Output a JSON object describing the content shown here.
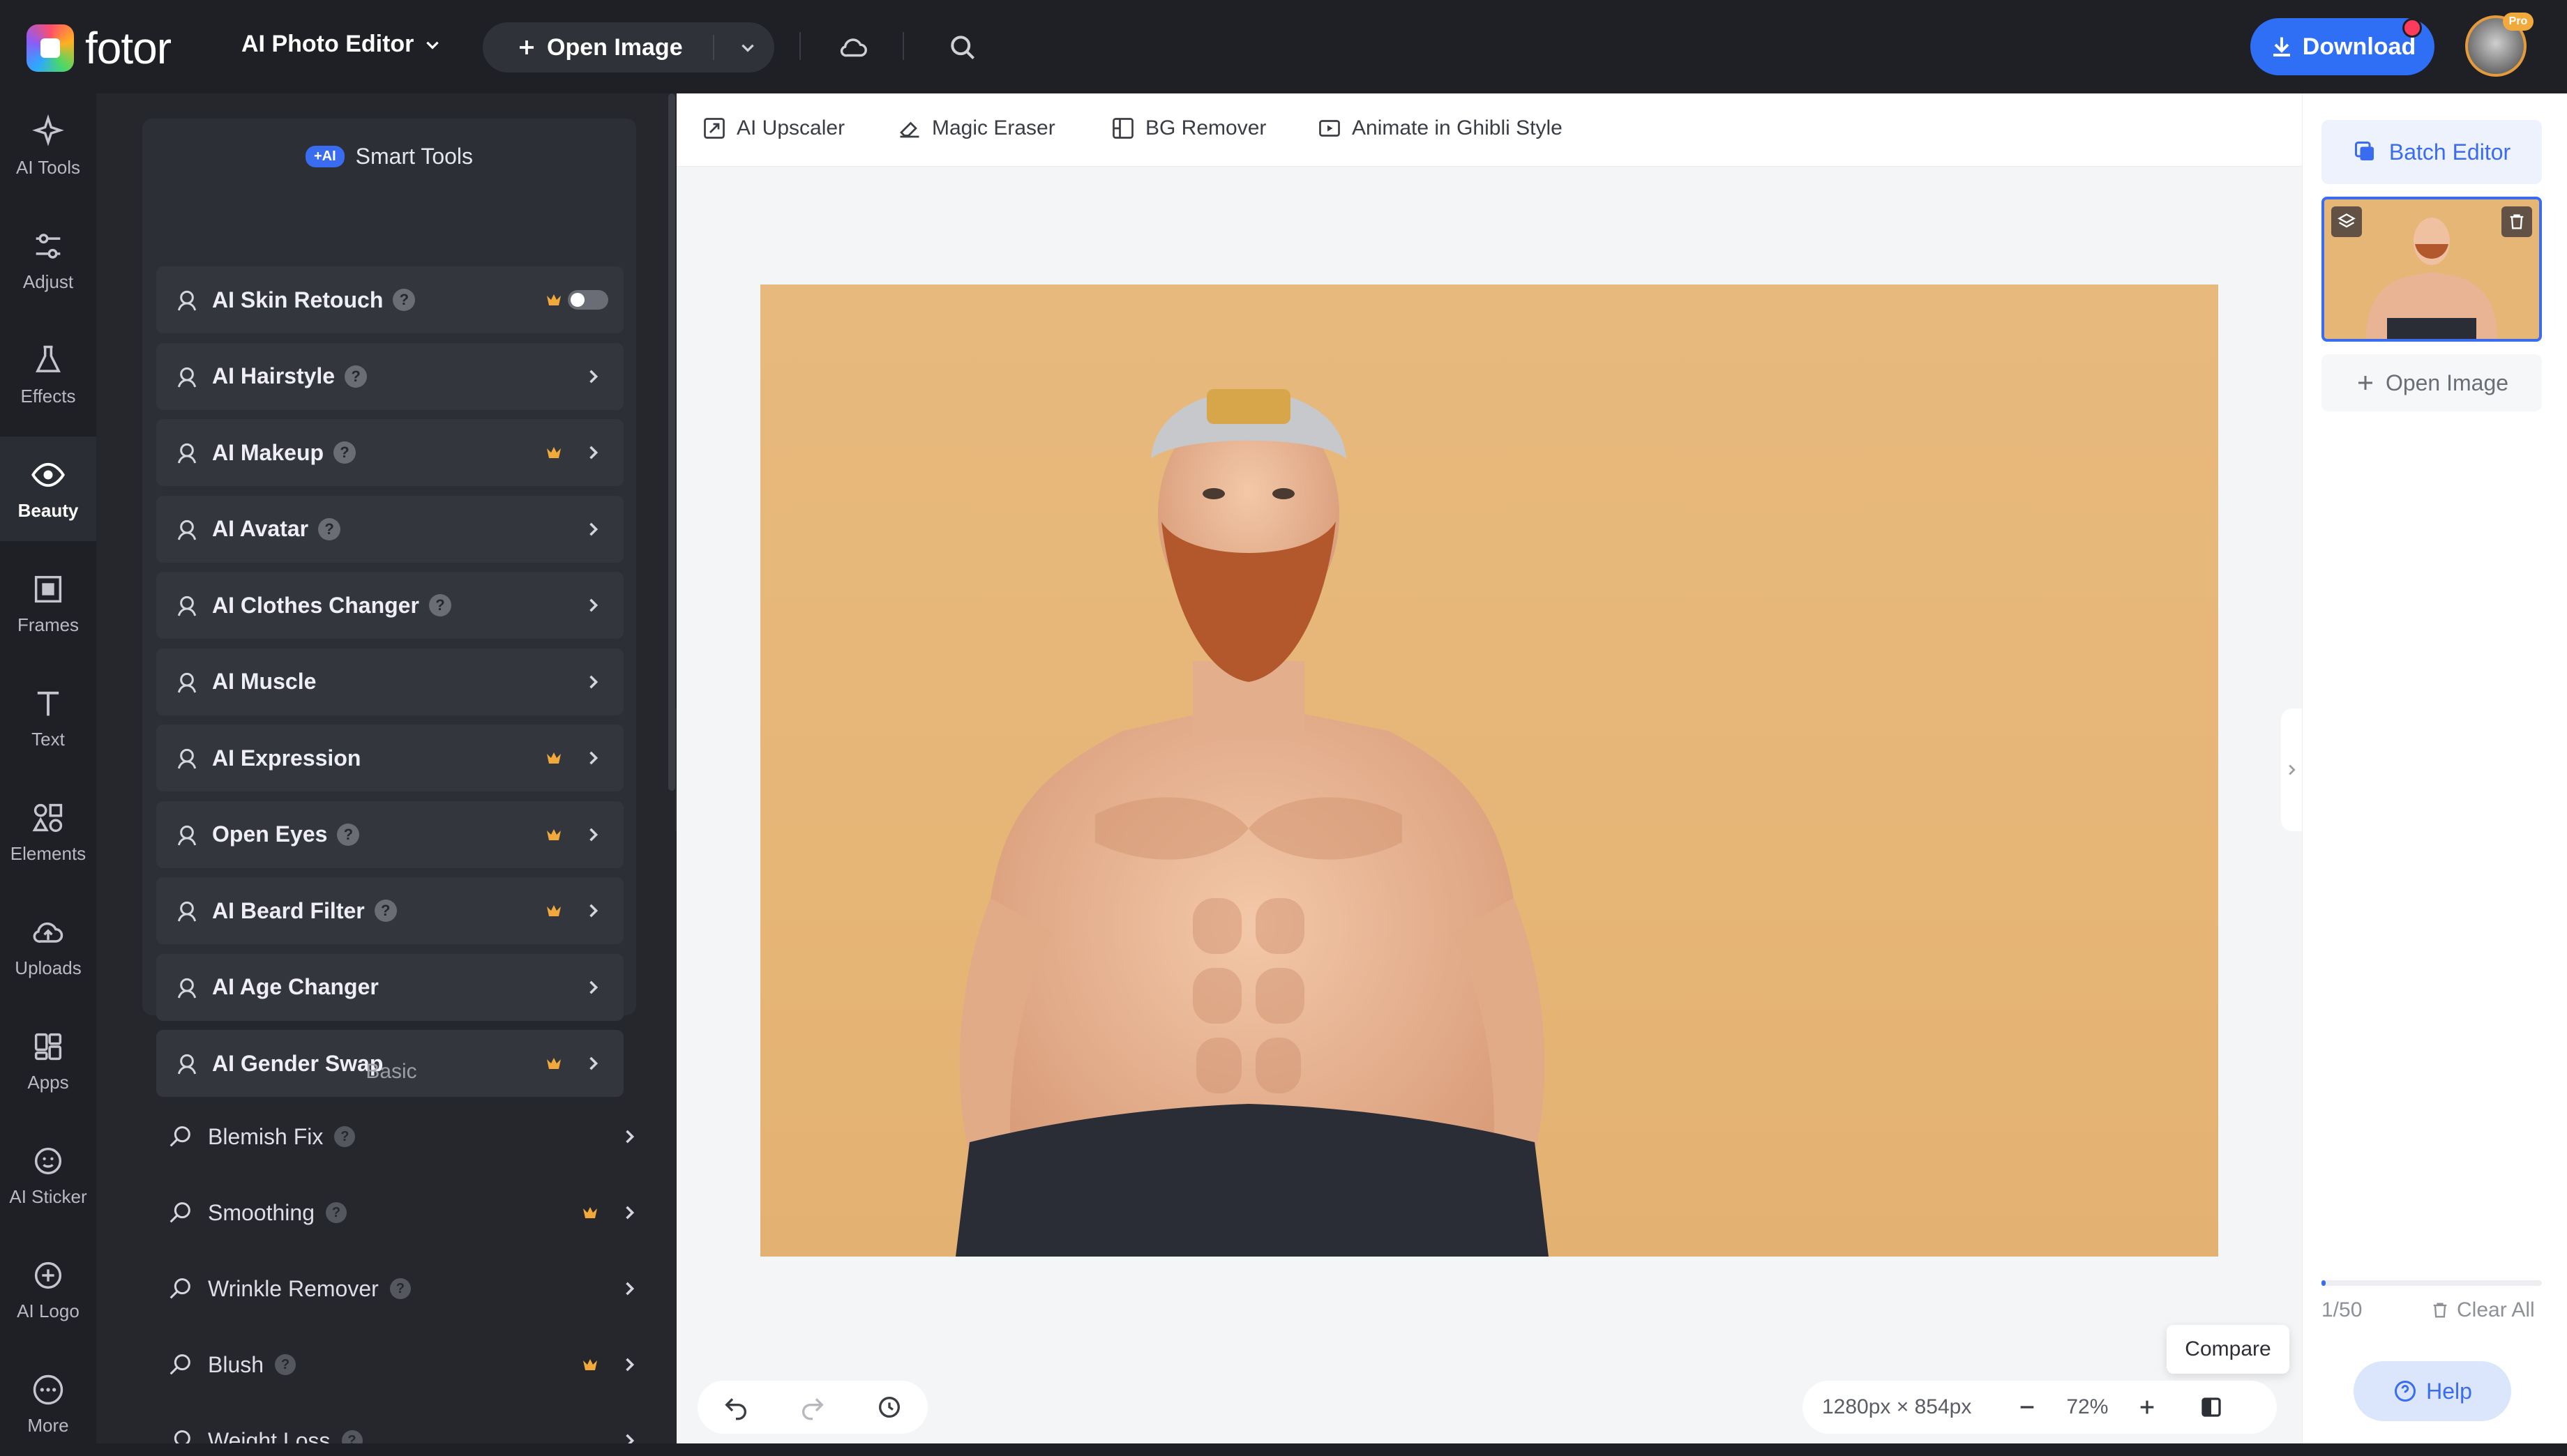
{
  "app": {
    "brand": "fotor",
    "editor_switch": "AI Photo Editor",
    "open_image": "Open Image",
    "download": "Download",
    "pro_badge": "Pro"
  },
  "rail": [
    {
      "label": "AI Tools",
      "icon": "sparkle-icon"
    },
    {
      "label": "Adjust",
      "icon": "sliders-icon"
    },
    {
      "label": "Effects",
      "icon": "flask-icon"
    },
    {
      "label": "Beauty",
      "icon": "eye-icon",
      "active": true
    },
    {
      "label": "Frames",
      "icon": "frame-icon"
    },
    {
      "label": "Text",
      "icon": "text-icon"
    },
    {
      "label": "Elements",
      "icon": "shapes-icon"
    },
    {
      "label": "Uploads",
      "icon": "upload-cloud-icon"
    },
    {
      "label": "Apps",
      "icon": "apps-icon"
    },
    {
      "label": "AI Sticker",
      "icon": "sticker-icon"
    },
    {
      "label": "AI Logo",
      "icon": "logo-icon"
    },
    {
      "label": "More",
      "icon": "more-icon"
    }
  ],
  "smart_tools": {
    "badge": "+AI",
    "title": "Smart Tools",
    "items": [
      {
        "label": "AI Skin Retouch",
        "help": true,
        "crown": true,
        "toggle": true
      },
      {
        "label": "AI Hairstyle",
        "help": true,
        "crown": false
      },
      {
        "label": "AI Makeup",
        "help": true,
        "crown": true
      },
      {
        "label": "AI Avatar",
        "help": true,
        "crown": false
      },
      {
        "label": "AI Clothes Changer",
        "help": true,
        "crown": false
      },
      {
        "label": "AI Muscle",
        "help": false,
        "crown": false
      },
      {
        "label": "AI Expression",
        "help": false,
        "crown": true
      },
      {
        "label": "Open Eyes",
        "help": true,
        "crown": true
      },
      {
        "label": "AI Beard Filter",
        "help": true,
        "crown": true
      },
      {
        "label": "AI Age Changer",
        "help": false,
        "crown": false
      },
      {
        "label": "AI Gender Swap",
        "help": false,
        "crown": true
      }
    ]
  },
  "basic": {
    "title": "Basic",
    "items": [
      {
        "label": "Blemish Fix",
        "help": true,
        "crown": false
      },
      {
        "label": "Smoothing",
        "help": true,
        "crown": true
      },
      {
        "label": "Wrinkle Remover",
        "help": true,
        "crown": false
      },
      {
        "label": "Blush",
        "help": true,
        "crown": true
      },
      {
        "label": "Weight Loss",
        "help": true,
        "crown": false
      }
    ]
  },
  "subtoolbar": [
    "AI Upscaler",
    "Magic Eraser",
    "BG Remover",
    "Animate in Ghibli Style"
  ],
  "canvas": {
    "dimensions": "1280px × 854px",
    "zoom": "72%",
    "compare_tooltip": "Compare"
  },
  "right_panel": {
    "batch_editor": "Batch Editor",
    "open_image": "Open Image",
    "count": "1/50",
    "clear_all": "Clear All",
    "help": "Help",
    "usage_fraction": 0.02
  },
  "colors": {
    "accent": "#2f6ff5",
    "crown": "#f2a93b",
    "canvas_bg": "#e6b677"
  }
}
